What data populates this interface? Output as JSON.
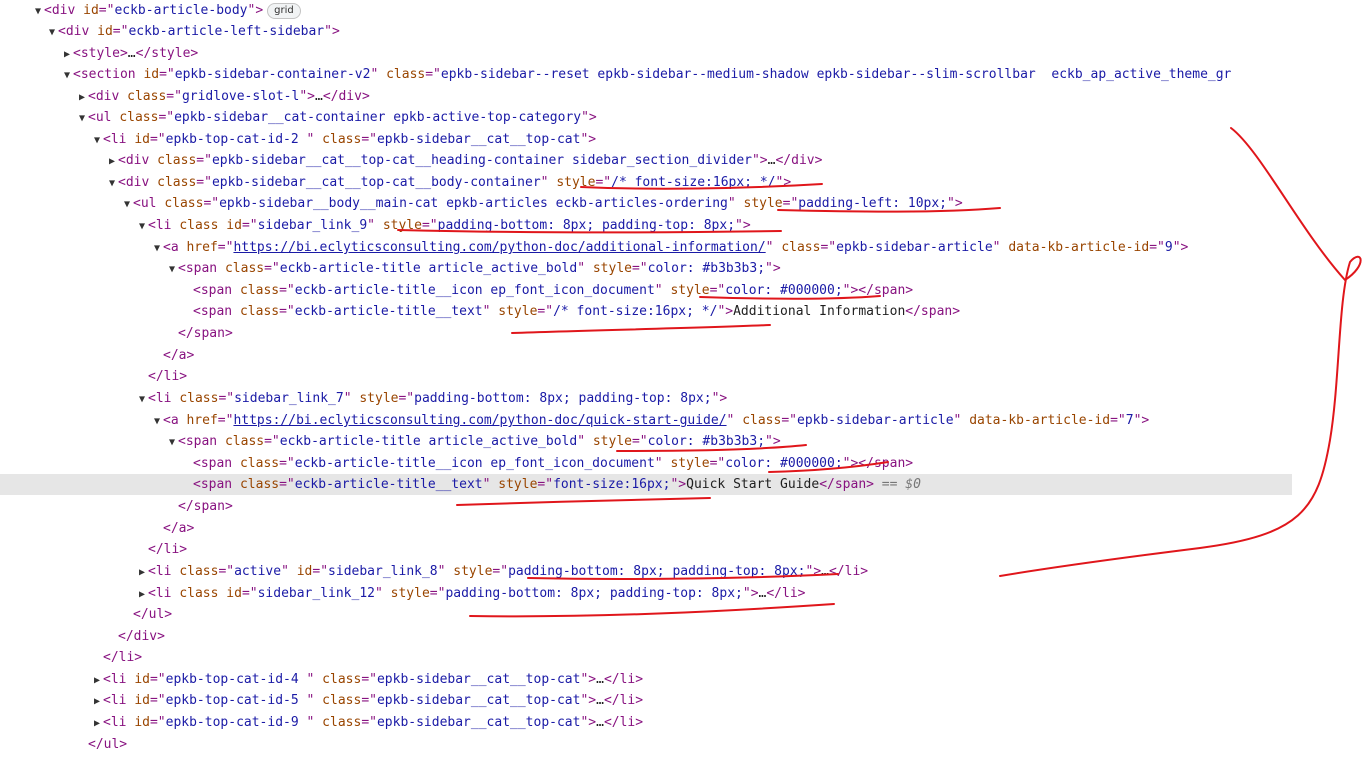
{
  "badge": "grid",
  "lines": [
    {
      "tw": "▼",
      "tks": [
        [
          "t",
          "<div "
        ],
        [
          "n",
          "id"
        ],
        [
          "t",
          "=\""
        ],
        [
          "v",
          "eckb-article-body"
        ],
        [
          "t",
          "\">"
        ]
      ],
      "badge": true
    },
    {
      "tw": "▼",
      "tks": [
        [
          "t",
          "<div "
        ],
        [
          "n",
          "id"
        ],
        [
          "t",
          "=\""
        ],
        [
          "v",
          "eckb-article-left-sidebar"
        ],
        [
          "t",
          "\">"
        ]
      ]
    },
    {
      "tw": "▶",
      "tks": [
        [
          "t",
          "<style>"
        ],
        [
          "x",
          "…"
        ],
        [
          "t",
          "</style>"
        ]
      ]
    },
    {
      "tw": "▼",
      "tks": [
        [
          "t",
          "<section "
        ],
        [
          "n",
          "id"
        ],
        [
          "t",
          "=\""
        ],
        [
          "v",
          "epkb-sidebar-container-v2"
        ],
        [
          "t",
          "\" "
        ],
        [
          "n",
          "class"
        ],
        [
          "t",
          "=\""
        ],
        [
          "v",
          "epkb-sidebar--reset epkb-sidebar--medium-shadow epkb-sidebar--slim-scrollbar  eckb_ap_active_theme_gr"
        ]
      ]
    },
    {
      "tw": "▶",
      "tks": [
        [
          "t",
          "<div "
        ],
        [
          "n",
          "class"
        ],
        [
          "t",
          "=\""
        ],
        [
          "v",
          "gridlove-slot-l"
        ],
        [
          "t",
          "\">"
        ],
        [
          "x",
          "…"
        ],
        [
          "t",
          "</div>"
        ]
      ]
    },
    {
      "tw": "▼",
      "tks": [
        [
          "t",
          "<ul "
        ],
        [
          "n",
          "class"
        ],
        [
          "t",
          "=\""
        ],
        [
          "v",
          "epkb-sidebar__cat-container epkb-active-top-category"
        ],
        [
          "t",
          "\">"
        ]
      ]
    },
    {
      "tw": "▼",
      "tks": [
        [
          "t",
          "<li "
        ],
        [
          "n",
          "id"
        ],
        [
          "t",
          "=\""
        ],
        [
          "v",
          "epkb-top-cat-id-2 "
        ],
        [
          "t",
          "\" "
        ],
        [
          "n",
          "class"
        ],
        [
          "t",
          "=\""
        ],
        [
          "v",
          "epkb-sidebar__cat__top-cat"
        ],
        [
          "t",
          "\">"
        ]
      ]
    },
    {
      "tw": "▶",
      "tks": [
        [
          "t",
          "<div "
        ],
        [
          "n",
          "class"
        ],
        [
          "t",
          "=\""
        ],
        [
          "v",
          "epkb-sidebar__cat__top-cat__heading-container sidebar_section_divider"
        ],
        [
          "t",
          "\">"
        ],
        [
          "x",
          "…"
        ],
        [
          "t",
          "</div>"
        ]
      ]
    },
    {
      "tw": "▼",
      "tks": [
        [
          "t",
          "<div "
        ],
        [
          "n",
          "class"
        ],
        [
          "t",
          "=\""
        ],
        [
          "v",
          "epkb-sidebar__cat__top-cat__body-container"
        ],
        [
          "t",
          "\" "
        ],
        [
          "n",
          "style"
        ],
        [
          "t",
          "=\""
        ],
        [
          "v",
          "/* font-size:16px; */"
        ],
        [
          "t",
          "\">"
        ]
      ]
    },
    {
      "tw": "▼",
      "tks": [
        [
          "t",
          "<ul "
        ],
        [
          "n",
          "class"
        ],
        [
          "t",
          "=\""
        ],
        [
          "v",
          "epkb-sidebar__body__main-cat epkb-articles eckb-articles-ordering"
        ],
        [
          "t",
          "\" "
        ],
        [
          "n",
          "style"
        ],
        [
          "t",
          "=\""
        ],
        [
          "v",
          "padding-left: 10px;"
        ],
        [
          "t",
          "\">"
        ]
      ]
    },
    {
      "tw": "▼",
      "tks": [
        [
          "t",
          "<li "
        ],
        [
          "n",
          "class"
        ],
        [
          "t",
          " "
        ],
        [
          "n",
          "id"
        ],
        [
          "t",
          "=\""
        ],
        [
          "v",
          "sidebar_link_9"
        ],
        [
          "t",
          "\" "
        ],
        [
          "n",
          "style"
        ],
        [
          "t",
          "=\""
        ],
        [
          "v",
          "padding-bottom: 8px; padding-top: 8px;"
        ],
        [
          "t",
          "\">"
        ]
      ]
    },
    {
      "tw": "▼",
      "tks": [
        [
          "t",
          "<a "
        ],
        [
          "n",
          "href"
        ],
        [
          "t",
          "=\""
        ],
        [
          "l",
          "https://bi.eclyticsconsulting.com/python-doc/additional-information/"
        ],
        [
          "t",
          "\" "
        ],
        [
          "n",
          "class"
        ],
        [
          "t",
          "=\""
        ],
        [
          "v",
          "epkb-sidebar-article"
        ],
        [
          "t",
          "\" "
        ],
        [
          "n",
          "data-kb-article-id"
        ],
        [
          "t",
          "=\""
        ],
        [
          "v",
          "9"
        ],
        [
          "t",
          "\">"
        ]
      ]
    },
    {
      "tw": "▼",
      "tks": [
        [
          "t",
          "<span "
        ],
        [
          "n",
          "class"
        ],
        [
          "t",
          "=\""
        ],
        [
          "v",
          "eckb-article-title article_active_bold"
        ],
        [
          "t",
          "\" "
        ],
        [
          "n",
          "style"
        ],
        [
          "t",
          "=\""
        ],
        [
          "v",
          "color: #b3b3b3;"
        ],
        [
          "t",
          "\">"
        ]
      ]
    },
    {
      "tw": "",
      "tks": [
        [
          "t",
          "<span "
        ],
        [
          "n",
          "class"
        ],
        [
          "t",
          "=\""
        ],
        [
          "v",
          "eckb-article-title__icon ep_font_icon_document"
        ],
        [
          "t",
          "\" "
        ],
        [
          "n",
          "style"
        ],
        [
          "t",
          "=\""
        ],
        [
          "v",
          "color: #000000;"
        ],
        [
          "t",
          "\"></span>"
        ]
      ]
    },
    {
      "tw": "",
      "tks": [
        [
          "t",
          "<span "
        ],
        [
          "n",
          "class"
        ],
        [
          "t",
          "=\""
        ],
        [
          "v",
          "eckb-article-title__text"
        ],
        [
          "t",
          "\" "
        ],
        [
          "n",
          "style"
        ],
        [
          "t",
          "=\""
        ],
        [
          "v",
          "/* font-size:16px; */"
        ],
        [
          "t",
          "\">"
        ],
        [
          "x",
          "Additional Information"
        ],
        [
          "t",
          "</span>"
        ]
      ]
    },
    {
      "tw": "",
      "tks": [
        [
          "t",
          "</span>"
        ]
      ]
    },
    {
      "tw": "",
      "tks": [
        [
          "t",
          "</a>"
        ]
      ]
    },
    {
      "tw": "",
      "tks": [
        [
          "t",
          "</li>"
        ]
      ]
    },
    {
      "tw": "▼",
      "tks": [
        [
          "t",
          "<li "
        ],
        [
          "n",
          "class"
        ],
        [
          "t",
          "=\""
        ],
        [
          "v",
          "sidebar_link_7"
        ],
        [
          "t",
          "\" "
        ],
        [
          "n",
          "style"
        ],
        [
          "t",
          "=\""
        ],
        [
          "v",
          "padding-bottom: 8px; padding-top: 8px;"
        ],
        [
          "t",
          "\">"
        ]
      ]
    },
    {
      "tw": "▼",
      "tks": [
        [
          "t",
          "<a "
        ],
        [
          "n",
          "href"
        ],
        [
          "t",
          "=\""
        ],
        [
          "l",
          "https://bi.eclyticsconsulting.com/python-doc/quick-start-guide/"
        ],
        [
          "t",
          "\" "
        ],
        [
          "n",
          "class"
        ],
        [
          "t",
          "=\""
        ],
        [
          "v",
          "epkb-sidebar-article"
        ],
        [
          "t",
          "\" "
        ],
        [
          "n",
          "data-kb-article-id"
        ],
        [
          "t",
          "=\""
        ],
        [
          "v",
          "7"
        ],
        [
          "t",
          "\">"
        ]
      ]
    },
    {
      "tw": "▼",
      "tks": [
        [
          "t",
          "<span "
        ],
        [
          "n",
          "class"
        ],
        [
          "t",
          "=\""
        ],
        [
          "v",
          "eckb-article-title article_active_bold"
        ],
        [
          "t",
          "\" "
        ],
        [
          "n",
          "style"
        ],
        [
          "t",
          "=\""
        ],
        [
          "v",
          "color: #b3b3b3;"
        ],
        [
          "t",
          "\">"
        ]
      ]
    },
    {
      "tw": "",
      "tks": [
        [
          "t",
          "<span "
        ],
        [
          "n",
          "class"
        ],
        [
          "t",
          "=\""
        ],
        [
          "v",
          "eckb-article-title__icon ep_font_icon_document"
        ],
        [
          "t",
          "\" "
        ],
        [
          "n",
          "style"
        ],
        [
          "t",
          "=\""
        ],
        [
          "v",
          "color: #000000;"
        ],
        [
          "t",
          "\"></span>"
        ]
      ]
    },
    {
      "tw": "",
      "sel": true,
      "tks": [
        [
          "t",
          "<span "
        ],
        [
          "n",
          "class"
        ],
        [
          "t",
          "=\""
        ],
        [
          "v",
          "eckb-article-title__text"
        ],
        [
          "t",
          "\" "
        ],
        [
          "n",
          "style"
        ],
        [
          "t",
          "=\""
        ],
        [
          "v",
          "font-size:16px;"
        ],
        [
          "t",
          "\">"
        ],
        [
          "x",
          "Quick Start Guide"
        ],
        [
          "t",
          "</span>"
        ],
        [
          "d",
          " == $0"
        ]
      ]
    },
    {
      "tw": "",
      "tks": [
        [
          "t",
          "</span>"
        ]
      ]
    },
    {
      "tw": "",
      "tks": [
        [
          "t",
          "</a>"
        ]
      ]
    },
    {
      "tw": "",
      "tks": [
        [
          "t",
          "</li>"
        ]
      ]
    },
    {
      "tw": "▶",
      "tks": [
        [
          "t",
          "<li "
        ],
        [
          "n",
          "class"
        ],
        [
          "t",
          "=\""
        ],
        [
          "v",
          "active"
        ],
        [
          "t",
          "\" "
        ],
        [
          "n",
          "id"
        ],
        [
          "t",
          "=\""
        ],
        [
          "v",
          "sidebar_link_8"
        ],
        [
          "t",
          "\" "
        ],
        [
          "n",
          "style"
        ],
        [
          "t",
          "=\""
        ],
        [
          "v",
          "padding-bottom: 8px; padding-top: 8px;"
        ],
        [
          "t",
          "\">"
        ],
        [
          "x",
          "…"
        ],
        [
          "t",
          "</li>"
        ]
      ]
    },
    {
      "tw": "▶",
      "tks": [
        [
          "t",
          "<li "
        ],
        [
          "n",
          "class"
        ],
        [
          "t",
          " "
        ],
        [
          "n",
          "id"
        ],
        [
          "t",
          "=\""
        ],
        [
          "v",
          "sidebar_link_12"
        ],
        [
          "t",
          "\" "
        ],
        [
          "n",
          "style"
        ],
        [
          "t",
          "=\""
        ],
        [
          "v",
          "padding-bottom: 8px; padding-top: 8px;"
        ],
        [
          "t",
          "\">"
        ],
        [
          "x",
          "…"
        ],
        [
          "t",
          "</li>"
        ]
      ]
    },
    {
      "tw": "",
      "tks": [
        [
          "t",
          "</ul>"
        ]
      ]
    },
    {
      "tw": "",
      "tks": [
        [
          "t",
          "</div>"
        ]
      ]
    },
    {
      "tw": "",
      "tks": [
        [
          "t",
          "</li>"
        ]
      ]
    },
    {
      "tw": "▶",
      "tks": [
        [
          "t",
          "<li "
        ],
        [
          "n",
          "id"
        ],
        [
          "t",
          "=\""
        ],
        [
          "v",
          "epkb-top-cat-id-4 "
        ],
        [
          "t",
          "\" "
        ],
        [
          "n",
          "class"
        ],
        [
          "t",
          "=\""
        ],
        [
          "v",
          "epkb-sidebar__cat__top-cat"
        ],
        [
          "t",
          "\">"
        ],
        [
          "x",
          "…"
        ],
        [
          "t",
          "</li>"
        ]
      ]
    },
    {
      "tw": "▶",
      "tks": [
        [
          "t",
          "<li "
        ],
        [
          "n",
          "id"
        ],
        [
          "t",
          "=\""
        ],
        [
          "v",
          "epkb-top-cat-id-5 "
        ],
        [
          "t",
          "\" "
        ],
        [
          "n",
          "class"
        ],
        [
          "t",
          "=\""
        ],
        [
          "v",
          "epkb-sidebar__cat__top-cat"
        ],
        [
          "t",
          "\">"
        ],
        [
          "x",
          "…"
        ],
        [
          "t",
          "</li>"
        ]
      ]
    },
    {
      "tw": "▶",
      "tks": [
        [
          "t",
          "<li "
        ],
        [
          "n",
          "id"
        ],
        [
          "t",
          "=\""
        ],
        [
          "v",
          "epkb-top-cat-id-9 "
        ],
        [
          "t",
          "\" "
        ],
        [
          "n",
          "class"
        ],
        [
          "t",
          "=\""
        ],
        [
          "v",
          "epkb-sidebar__cat__top-cat"
        ],
        [
          "t",
          "\">"
        ],
        [
          "x",
          "…"
        ],
        [
          "t",
          "</li>"
        ]
      ]
    },
    {
      "tw": "",
      "tks": [
        [
          "t",
          "</ul>"
        ]
      ]
    }
  ]
}
